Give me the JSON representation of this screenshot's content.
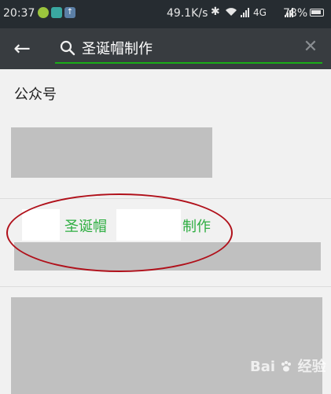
{
  "status_bar": {
    "time": "20:37",
    "network_speed": "49.1K/s",
    "network_type": "4G",
    "battery": "78%"
  },
  "search": {
    "back_icon": "arrow-left-icon",
    "search_icon": "search-icon",
    "query": "圣诞帽制作",
    "clear_icon": "close-icon",
    "accent_color": "#1aad19"
  },
  "results": {
    "section_title": "公众号",
    "highlighted_item": {
      "title_part1": "圣诞帽",
      "title_part2": "制作",
      "highlight_color": "#2fae42"
    }
  },
  "watermark": {
    "text": "Bai",
    "suffix": "经验"
  },
  "colors": {
    "status_bar_bg": "#262c31",
    "header_bg": "#383c40",
    "annotation_ellipse": "#b0101a"
  }
}
